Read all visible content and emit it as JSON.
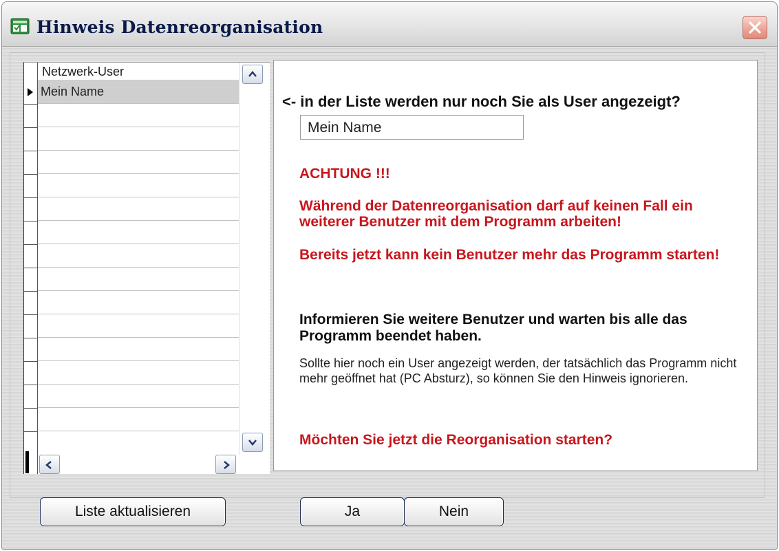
{
  "window": {
    "title": "Hinweis Datenreorganisation"
  },
  "grid": {
    "header": "Netzwerk-User",
    "rows": [
      "Mein Name",
      "",
      "",
      "",
      "",
      "",
      "",
      "",
      "",
      "",
      "",
      "",
      "",
      "",
      "",
      ""
    ]
  },
  "panel": {
    "question": "<- in der Liste werden nur noch Sie als User angezeigt?",
    "user_value": "Mein Name",
    "achtung": "ACHTUNG !!!",
    "warning1": "Während der Datenreorganisation darf auf keinen Fall ein weiterer Benutzer mit dem Programm arbeiten!",
    "warning2": "Bereits jetzt kann kein Benutzer mehr das Programm starten!",
    "inform": "Informieren Sie weitere Benutzer und warten bis alle das Programm beendet haben.",
    "note": "Sollte hier noch ein User angezeigt werden, der tatsächlich das Programm nicht mehr geöffnet hat (PC Absturz), so können Sie den Hinweis ignorieren.",
    "final_question": "Möchten Sie jetzt die Reorganisation starten?"
  },
  "buttons": {
    "refresh": "Liste aktualisieren",
    "yes": "Ja",
    "no": "Nein"
  },
  "colors": {
    "warning": "#c8161d",
    "button_border": "#1b2c56"
  },
  "icons": [
    "app-icon",
    "close-icon",
    "row-selector-icon",
    "scroll-up-icon",
    "scroll-down-icon",
    "scroll-left-icon",
    "scroll-right-icon"
  ]
}
